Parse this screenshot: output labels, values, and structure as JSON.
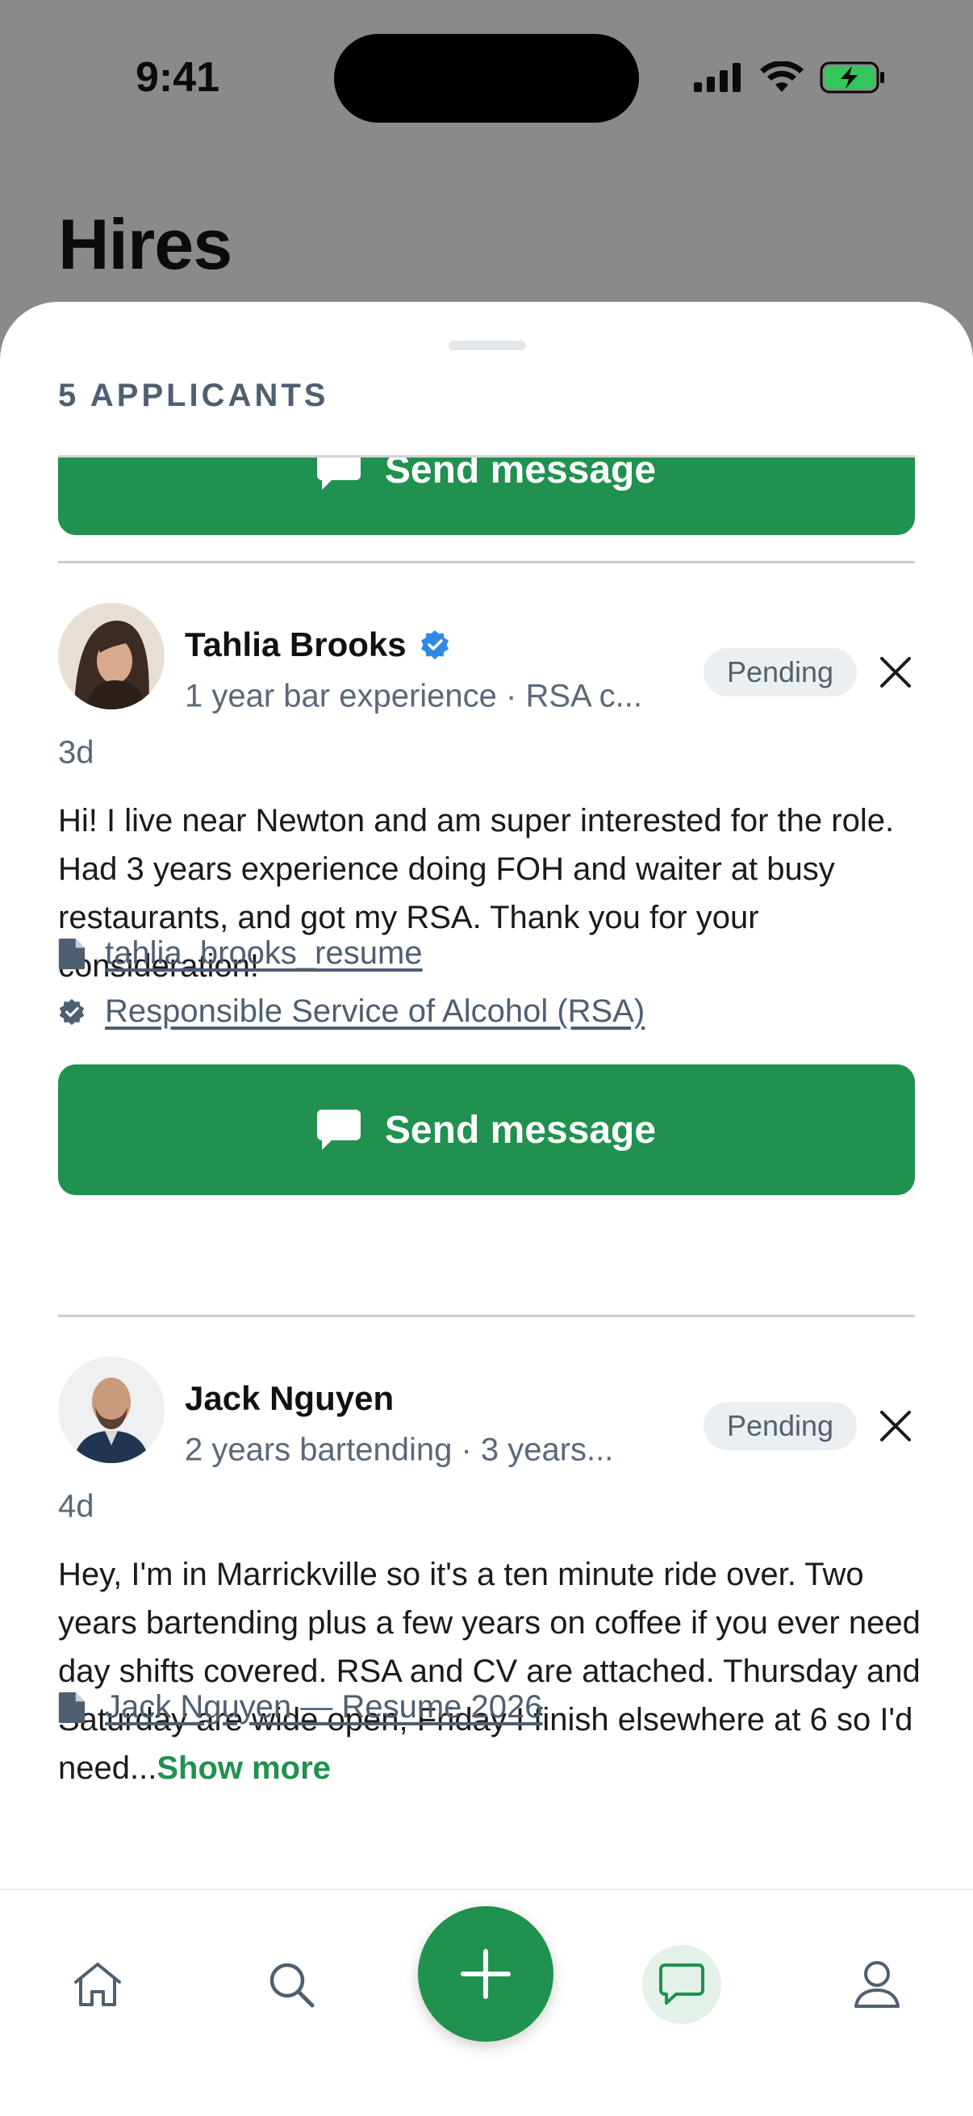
{
  "status_bar": {
    "time": "9:41"
  },
  "page": {
    "title": "Hires"
  },
  "sheet": {
    "count_label": "5 APPLICANTS"
  },
  "actions": {
    "send_message_label": "Send message"
  },
  "applicants": [
    {
      "name": "Tahlia Brooks",
      "verified": true,
      "subline": "1 year bar experience · RSA c...",
      "status": "Pending",
      "ago": "3d",
      "message": "Hi! I live near Newton and am super interested for the role. Had 3 years experience doing FOH and waiter at busy restaurants, and got my RSA. Thank you for your consideration!",
      "attachments": [
        {
          "icon": "document-icon",
          "label": "tahlia_brooks_resume"
        },
        {
          "icon": "verified-certificate-icon",
          "label": "Responsible Service of Alcohol (RSA)"
        }
      ]
    },
    {
      "name": "Jack Nguyen",
      "verified": false,
      "subline": "2 years bartending · 3 years...",
      "status": "Pending",
      "ago": "4d",
      "message": "Hey, I'm in Marrickville so it's a ten minute ride over. Two years bartending plus a few years on coffee if you ever need day shifts covered. RSA and CV are attached. Thursday and Saturday are wide open; Friday I finish elsewhere at 6 so I'd need...",
      "show_more": "Show more",
      "attachments": [
        {
          "icon": "document-icon",
          "label": "Jack Nguyen — Resume 2026"
        }
      ]
    }
  ],
  "bottom_nav": [
    {
      "icon": "home-icon"
    },
    {
      "icon": "search-icon"
    },
    {
      "icon": "plus-icon"
    },
    {
      "icon": "chat-icon",
      "active": true
    },
    {
      "icon": "profile-icon"
    }
  ],
  "colors": {
    "accent": "#20914f",
    "muted_text": "#5a6878",
    "badge_bg": "#eceff1"
  }
}
